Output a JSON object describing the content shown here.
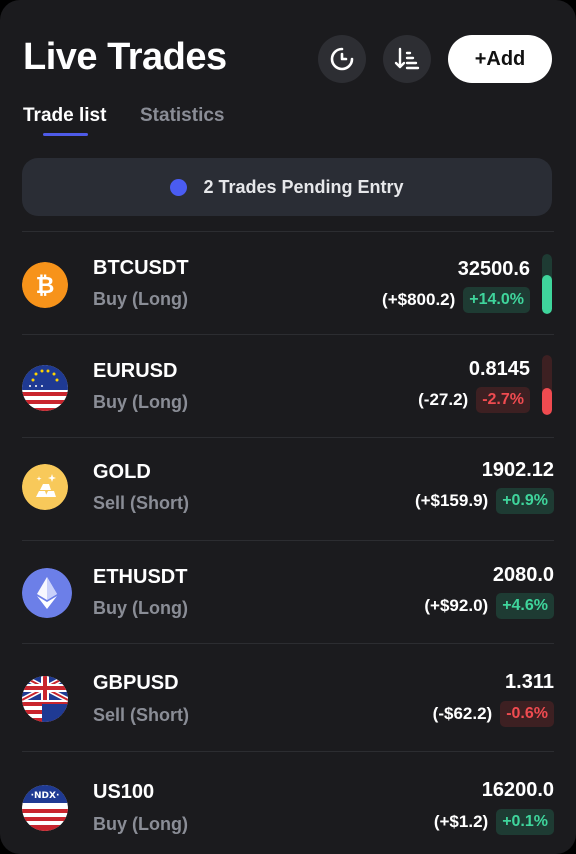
{
  "header": {
    "title": "Live Trades",
    "add_label": "+Add"
  },
  "tabs": [
    {
      "label": "Trade list",
      "active": true
    },
    {
      "label": "Statistics",
      "active": false
    }
  ],
  "pending": {
    "text": "2 Trades Pending Entry",
    "dot_color": "#4a5cf2"
  },
  "colors": {
    "positive": "#3fd59c",
    "negative": "#f04b50",
    "accent": "#4e5be8"
  },
  "trades": [
    {
      "symbol": "BTCUSDT",
      "side": "Buy (Long)",
      "price": "32500.6",
      "pnl": "(+$800.2)",
      "change": "+14.0%",
      "direction": "positive",
      "icon": "bitcoin-icon",
      "meter_fraction": 0.65
    },
    {
      "symbol": "EURUSD",
      "side": "Buy (Long)",
      "price": "0.8145",
      "pnl": "(-27.2)",
      "change": "-2.7%",
      "direction": "negative",
      "icon": "eu-us-flag-icon",
      "meter_fraction": 0.45
    },
    {
      "symbol": "GOLD",
      "side": "Sell (Short)",
      "price": "1902.12",
      "pnl": "(+$159.9)",
      "change": "+0.9%",
      "direction": "positive",
      "icon": "gold-bars-icon"
    },
    {
      "symbol": "ETHUSDT",
      "side": "Buy (Long)",
      "price": "2080.0",
      "pnl": "(+$92.0)",
      "change": "+4.6%",
      "direction": "positive",
      "icon": "ethereum-icon"
    },
    {
      "symbol": "GBPUSD",
      "side": "Sell (Short)",
      "price": "1.311",
      "pnl": "(-$62.2)",
      "change": "-0.6%",
      "direction": "negative",
      "icon": "uk-us-flag-icon"
    },
    {
      "symbol": "US100",
      "side": "Buy (Long)",
      "price": "16200.0",
      "pnl": "(+$1.2)",
      "change": "+0.1%",
      "direction": "positive",
      "icon": "ndx-icon"
    }
  ]
}
